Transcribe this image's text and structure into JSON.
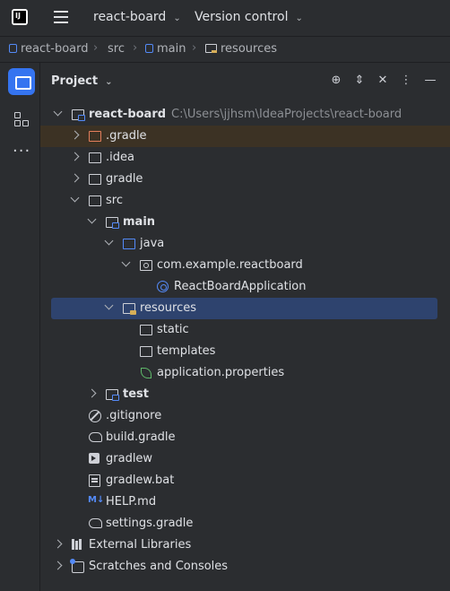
{
  "titlebar": {
    "logo_text": "IJ",
    "project_name": "react-board",
    "vcs_label": "Version control"
  },
  "breadcrumb": {
    "items": [
      "react-board",
      "src",
      "main",
      "resources"
    ],
    "separator": "›"
  },
  "toolwindow": {
    "title": "Project",
    "actions": [
      "locate-icon",
      "expand-collapse-icon",
      "collapse-all-icon",
      "more-icon",
      "minimize-icon"
    ]
  },
  "tree": [
    {
      "label": "react-board",
      "hint": "C:\\Users\\jjhsm\\IdeaProjects\\react-board",
      "icon": "module-folder-icon",
      "expanded": true,
      "level": 0,
      "bold": true
    },
    {
      "label": ".gradle",
      "icon": "excluded-folder-icon",
      "expanded": false,
      "level": 1,
      "highlighted": true
    },
    {
      "label": ".idea",
      "icon": "folder-icon",
      "expanded": false,
      "level": 1
    },
    {
      "label": "gradle",
      "icon": "folder-icon",
      "expanded": false,
      "level": 1
    },
    {
      "label": "src",
      "icon": "folder-icon",
      "expanded": true,
      "level": 1
    },
    {
      "label": "main",
      "icon": "module-folder-icon",
      "expanded": true,
      "level": 2,
      "bold": true
    },
    {
      "label": "java",
      "icon": "source-folder-icon",
      "expanded": true,
      "level": 3
    },
    {
      "label": "com.example.reactboard",
      "icon": "package-icon",
      "expanded": true,
      "level": 4
    },
    {
      "label": "ReactBoardApplication",
      "icon": "spring-class-icon",
      "level": 5
    },
    {
      "label": "resources",
      "icon": "resources-folder-icon",
      "expanded": true,
      "level": 3,
      "selected": true
    },
    {
      "label": "static",
      "icon": "folder-icon",
      "level": 4
    },
    {
      "label": "templates",
      "icon": "folder-icon",
      "level": 4
    },
    {
      "label": "application.properties",
      "icon": "spring-properties-icon",
      "level": 4
    },
    {
      "label": "test",
      "icon": "module-folder-icon",
      "expanded": false,
      "level": 2,
      "bold": true
    },
    {
      "label": ".gitignore",
      "icon": "gitignore-icon",
      "level": 1
    },
    {
      "label": "build.gradle",
      "icon": "gradle-icon",
      "level": 1
    },
    {
      "label": "gradlew",
      "icon": "terminal-icon",
      "level": 1
    },
    {
      "label": "gradlew.bat",
      "icon": "batch-file-icon",
      "level": 1
    },
    {
      "label": "HELP.md",
      "icon": "markdown-icon",
      "level": 1
    },
    {
      "label": "settings.gradle",
      "icon": "gradle-icon",
      "level": 1
    },
    {
      "label": "External Libraries",
      "icon": "libraries-icon",
      "expanded": false,
      "level": 0
    },
    {
      "label": "Scratches and Consoles",
      "icon": "scratches-icon",
      "expanded": false,
      "level": 0
    }
  ],
  "md_icon_text": "M↓",
  "colors": {
    "background": "#2b2d30",
    "selection": "#2e436e",
    "highlight": "#3c3224",
    "accent": "#3574f0"
  }
}
